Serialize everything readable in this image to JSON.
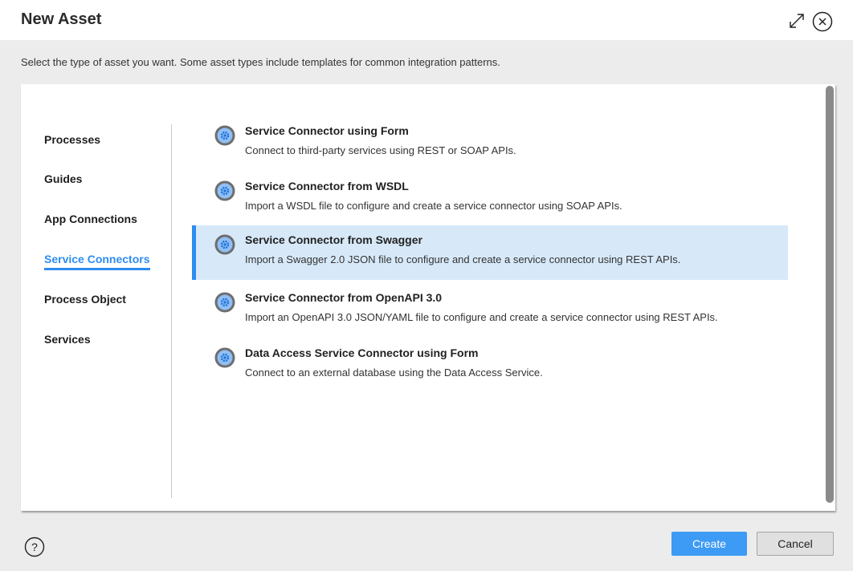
{
  "dialog": {
    "title": "New Asset",
    "subtitle": "Select the type of asset you want. Some asset types include templates for common integration patterns."
  },
  "header_icons": {
    "expand": "expand-icon",
    "close": "close-icon"
  },
  "sidebar": {
    "items": [
      {
        "label": "Processes",
        "active": false
      },
      {
        "label": "Guides",
        "active": false
      },
      {
        "label": "App Connections",
        "active": false
      },
      {
        "label": "Service Connectors",
        "active": true
      },
      {
        "label": "Process Object",
        "active": false
      },
      {
        "label": "Services",
        "active": false
      }
    ]
  },
  "options": [
    {
      "title": "Service Connector using Form",
      "description": "Connect to third-party services using REST or SOAP APIs.",
      "icon": "gear-icon",
      "selected": false
    },
    {
      "title": "Service Connector from WSDL",
      "description": "Import a WSDL file to configure and create a service connector using SOAP APIs.",
      "icon": "gear-icon",
      "selected": false
    },
    {
      "title": "Service Connector from Swagger",
      "description": "Import a Swagger 2.0 JSON file to configure and create a service connector using REST APIs.",
      "icon": "gear-icon",
      "selected": true
    },
    {
      "title": "Service Connector from OpenAPI 3.0",
      "description": "Import an OpenAPI 3.0 JSON/YAML file to configure and create a service connector using REST APIs.",
      "icon": "gear-icon",
      "selected": false
    },
    {
      "title": "Data Access Service Connector using Form",
      "description": "Connect to an external database using the Data Access Service.",
      "icon": "gear-icon",
      "selected": false
    }
  ],
  "footer": {
    "help_icon": "help-icon",
    "create_label": "Create",
    "cancel_label": "Cancel"
  },
  "colors": {
    "accent": "#2d8cf0",
    "selected_bg": "#d7e9f9",
    "primary_button": "#3d9bf5",
    "background": "#ececec"
  }
}
